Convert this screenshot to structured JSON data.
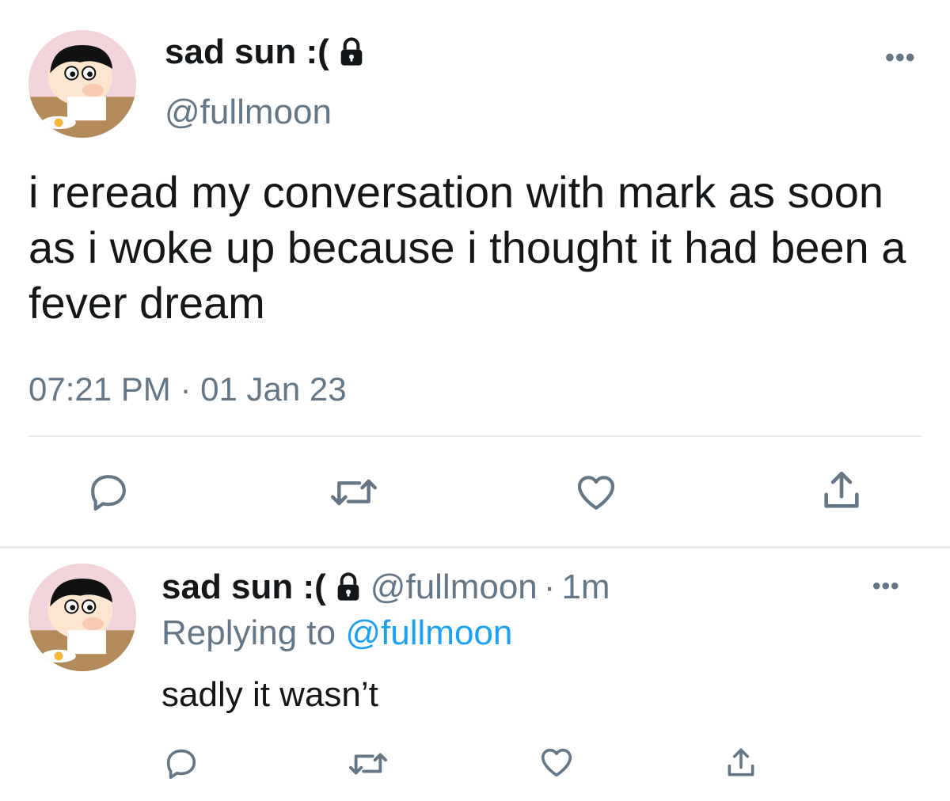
{
  "main_tweet": {
    "display_name": "sad sun :(",
    "handle": "@fullmoon",
    "text": "i reread my conversation with mark as soon as i woke up because i thought it had been a fever dream",
    "timestamp": "07:21 PM · 01 Jan 23",
    "more_label": "•••",
    "icons": {
      "verified_lock": "lock-icon",
      "reply": "reply-icon",
      "retweet": "retweet-icon",
      "like": "heart-icon",
      "share": "share-icon"
    }
  },
  "reply_tweet": {
    "display_name": "sad sun :(",
    "handle": "@fullmoon",
    "separator": "·",
    "age": "1m",
    "replying_prefix": "Replying to",
    "replying_handle": "@fullmoon",
    "text": "sadly it wasn’t",
    "more_label": "•••"
  },
  "colors": {
    "text": "#14171a",
    "muted": "#657786",
    "link": "#1da1f2",
    "divider": "#e6ecf0"
  }
}
